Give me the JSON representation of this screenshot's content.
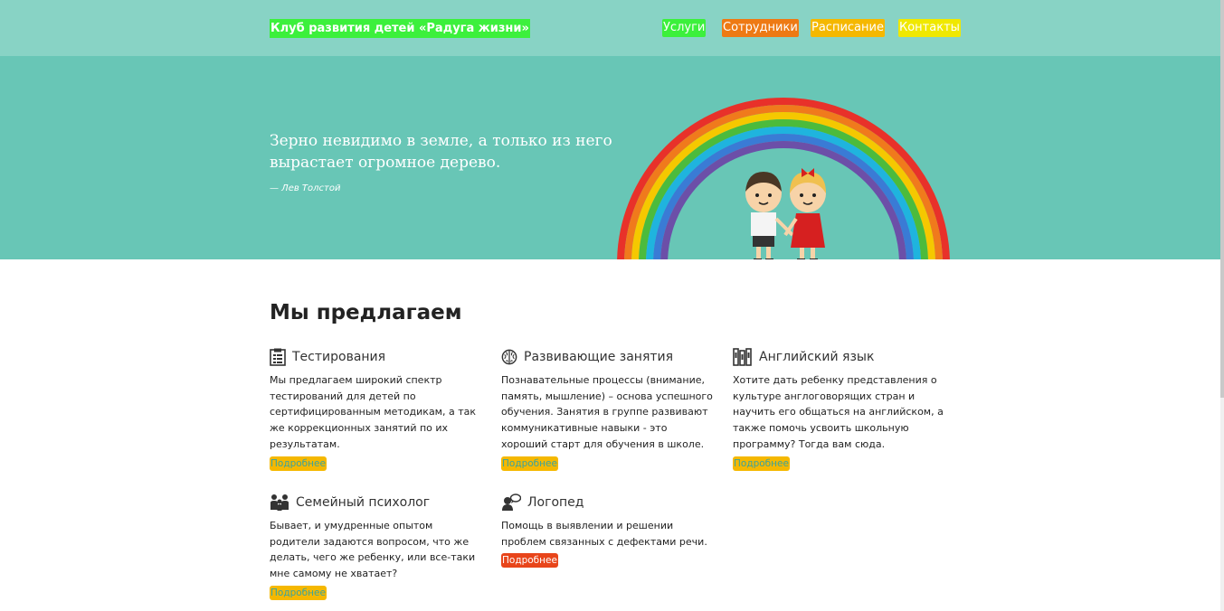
{
  "header": {
    "brand": "Клуб развития детей «Радуга жизни»",
    "nav": [
      "Услуги",
      "Сотрудники",
      "Расписание",
      "Контакты"
    ]
  },
  "hero": {
    "quote": "Зерно невидимо в земле, а только из него вырастает огромное дерево.",
    "author": "— Лев Толстой"
  },
  "offers": {
    "title": "Мы предлагаем",
    "items": [
      {
        "icon": "clipboard-icon",
        "title": "Тестирования",
        "text": "Мы предлагаем широкий спектр тестирований для детей по сертифицированным методикам, а так же коррекционных занятий по их результатам.",
        "more": "Подробнее"
      },
      {
        "icon": "brain-icon",
        "title": "Развивающие занятия",
        "text": "Познавательные процессы (внимание, память, мышление) – основа успешного обучения. Занятия в группе развивают коммуникативные навыки - это хороший старт для обучения в школе.",
        "more": "Подробнее"
      },
      {
        "icon": "books-icon",
        "title": "Английский язык",
        "text": "Хотите дать ребенку представления о культуре англоговорящих стран и научить его общаться на английском, а также помочь усвоить школьную программу? Тогда вам сюда.",
        "more": "Подробнее"
      },
      {
        "icon": "family-icon",
        "title": "Семейный психолог",
        "text": "Бывает, и умудренные опытом родители задаются вопросом, что же делать, чего же ребенку, или все-таки мне самому не хватает?",
        "more": "Подробнее"
      },
      {
        "icon": "speech-person-icon",
        "title": "Логопед",
        "text": "Помощь в выявлении и решении проблем связанных с дефектами речи.",
        "more": "Подробнее"
      }
    ]
  },
  "colors": {
    "topbar": "#88d3c5",
    "hero": "#68c6b6",
    "rainbow": [
      "#e8312a",
      "#f07a1c",
      "#f5c800",
      "#4cbb3c",
      "#1fb4de",
      "#3a7bd5",
      "#6c4fa8"
    ]
  }
}
